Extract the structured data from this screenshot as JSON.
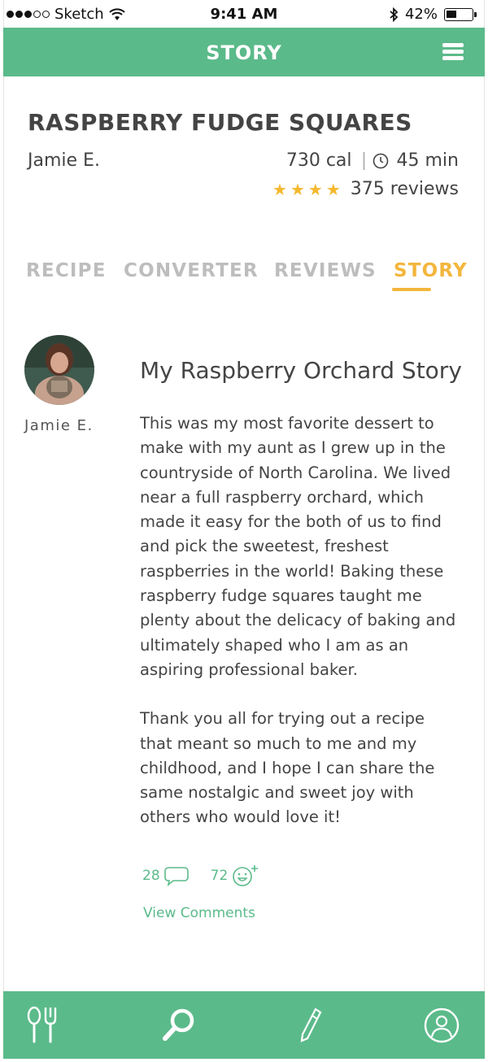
{
  "status_bar": {
    "carrier": "Sketch",
    "time": "9:41 AM",
    "battery_percent": "42%",
    "battery_level": 0.42
  },
  "header": {
    "title": "STORY",
    "menu_icon": "hamburger-menu-icon"
  },
  "recipe": {
    "title": "RASPBERRY FUDGE SQUARES",
    "author": "Jamie E.",
    "calories": "730 cal",
    "time": "45 min",
    "rating_stars": 4,
    "reviews": "375 reviews"
  },
  "tabs": [
    {
      "label": "RECIPE",
      "active": false
    },
    {
      "label": "CONVERTER",
      "active": false
    },
    {
      "label": "REVIEWS",
      "active": false
    },
    {
      "label": "STORY",
      "active": true
    }
  ],
  "story": {
    "author_name": "Jamie E.",
    "title": "My Raspberry Orchard Story",
    "paragraphs": [
      "This was my most favorite dessert to make with my aunt as I grew up in the countryside of North Carolina. We lived near a full raspberry orchard, which made it easy for the both of us to find and pick the sweetest, freshest raspberries in the world! Baking these raspberry fudge squares taught me plenty about the delicacy of baking and ultimately shaped who I am as an aspiring professional baker.",
      "Thank you all for trying out a recipe that meant so much to me and my childhood, and I hope I can share the same nostalgic and sweet joy with others who would love it!"
    ],
    "comment_count": "28",
    "reaction_count": "72",
    "view_comments_label": "View Comments"
  },
  "colors": {
    "brand_green": "#5bba8a",
    "accent_yellow": "#f3b63c",
    "star_color": "#f5b82e"
  },
  "bottom_nav": [
    {
      "name": "utensils-icon"
    },
    {
      "name": "search-icon"
    },
    {
      "name": "pencil-icon"
    },
    {
      "name": "profile-icon"
    }
  ]
}
